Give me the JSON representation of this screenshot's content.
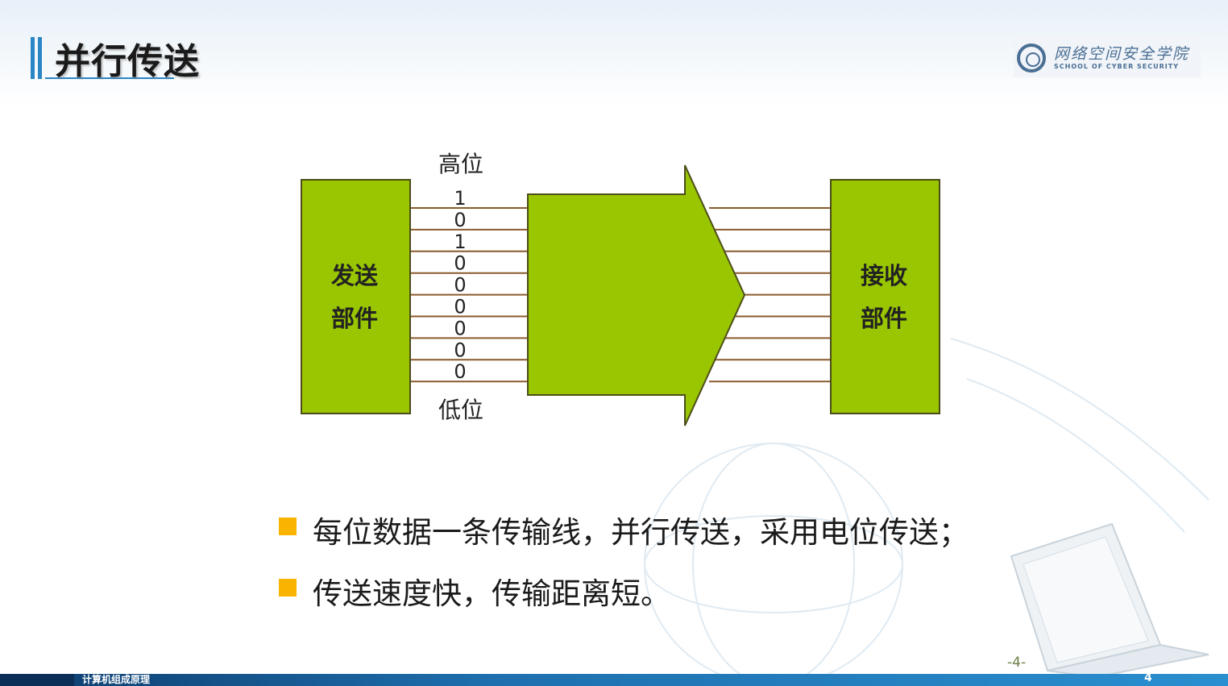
{
  "slide": {
    "title": "并行传送",
    "page_mark": "-4-"
  },
  "logo": {
    "name_cn": "网络空间安全学院",
    "name_en": "SCHOOL OF CYBER SECURITY"
  },
  "diagram": {
    "sender_label_1": "发送",
    "sender_label_2": "部件",
    "receiver_label_1": "接收",
    "receiver_label_2": "部件",
    "high_bit_label": "高位",
    "low_bit_label": "低位",
    "bits": [
      "1",
      "0",
      "1",
      "0",
      "0",
      "0",
      "0",
      "0",
      "0"
    ],
    "colors": {
      "block_fill": "#99c600",
      "block_stroke": "#4d4d1a",
      "line": "#8a5a2e"
    }
  },
  "bullets": [
    "每位数据一条传输线，并行传送，采用电位传送；",
    "传送速度快，传输距离短。"
  ],
  "footer": {
    "course": "计算机组成原理",
    "page_number": "4"
  },
  "colors": {
    "accent_blue": "#2b86c5",
    "bullet": "#f8b400",
    "footer": "#1e6fae"
  }
}
